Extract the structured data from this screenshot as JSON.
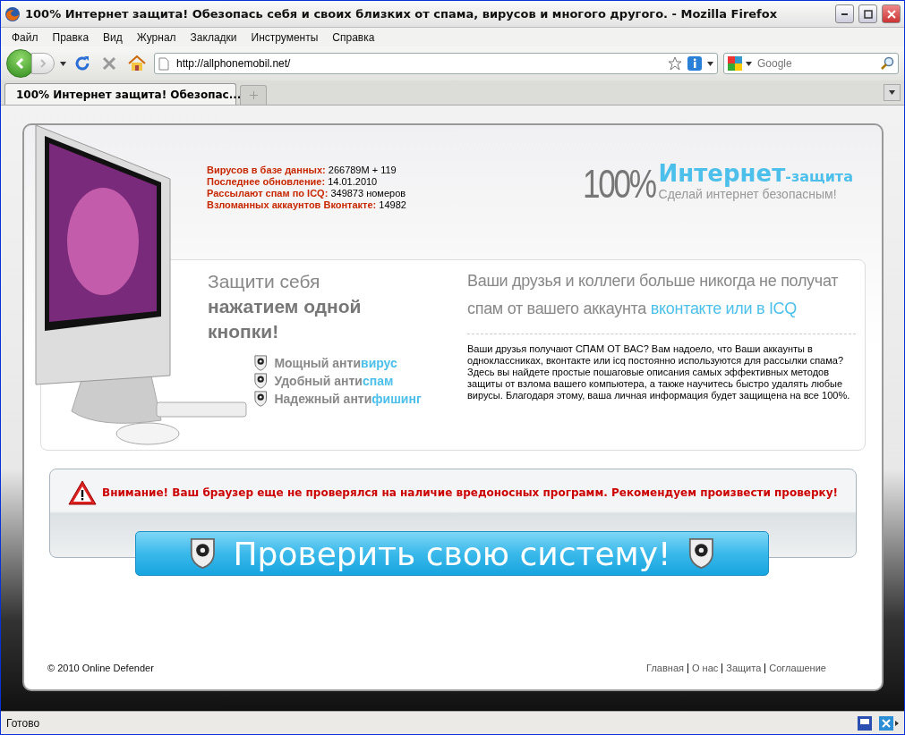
{
  "window": {
    "title": "100% Интернет защита! Обезопась себя и своих близких от спама, вирусов и многого другого. - Mozilla Firefox"
  },
  "menu": [
    "Файл",
    "Правка",
    "Вид",
    "Журнал",
    "Закладки",
    "Инструменты",
    "Справка"
  ],
  "address": {
    "value": "http://allphonemobil.net/"
  },
  "search": {
    "placeholder": "Google"
  },
  "tabs": [
    {
      "label": "100% Интернет защита! Обезопас...",
      "selected": true
    }
  ],
  "stats": [
    {
      "label": "Вирусов в базе данных:",
      "value": "266789M + 119"
    },
    {
      "label": "Последнее обновление:",
      "value": "14.01.2010"
    },
    {
      "label": "Рассылают спам по ICQ:",
      "value": "349873 номеров"
    },
    {
      "label": "Взломанных аккаунтов Вконтакте:",
      "value": "14982"
    }
  ],
  "logo": {
    "percent": "100%",
    "brand": "Интернет",
    "suffix": "-защита",
    "tagline": "Сделай интернет безопасным!"
  },
  "promo": {
    "light": "Защити себя",
    "bold": "нажатием одной кнопки!"
  },
  "features": [
    {
      "prefix": "Мощный анти",
      "highlight": "вирус"
    },
    {
      "prefix": "Удобный анти",
      "highlight": "спам"
    },
    {
      "prefix": "Надежный анти",
      "highlight": "фишинг"
    }
  ],
  "info": {
    "heading": "Ваши друзья и коллеги больше никогда не получат спам от вашего аккаунта",
    "highlight": "вконтакте или в ICQ",
    "body": "Ваши друзья получают СПАМ ОТ ВАС? Вам надоело, что Ваши аккаунты в одноклассниках, вконтакте или icq постоянно используются для рассылки спама? Здесь вы найдете простые пошаговые описания самых эффективных методов защиты от взлома вашего компьютера, а также научитесь быстро удалять любые вирусы. Благодаря этому, ваша личная информация будет защищена на все 100%."
  },
  "alert": "Внимание! Ваш браузер еще не проверялся на наличие вредоносных программ. Рекомендуем произвести проверку!",
  "check_button": "Проверить свою систему!",
  "footer": {
    "copyright": "© 2010 Online Defender",
    "links": [
      "Главная",
      "О нас",
      "Защита",
      "Соглашение"
    ]
  },
  "status_bar": "Готово"
}
